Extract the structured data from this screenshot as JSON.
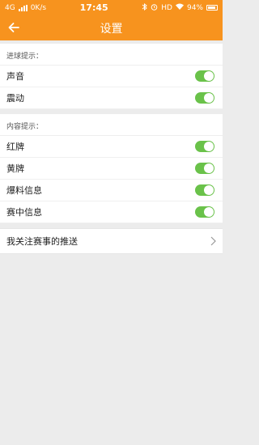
{
  "status": {
    "network": "4G",
    "speed": "0K/s",
    "time": "17:45",
    "hd": "HD",
    "battery": "94%"
  },
  "header": {
    "title": "设置"
  },
  "sections": {
    "goal": {
      "label": "进球提示：",
      "items": [
        {
          "label": "声音",
          "on": true
        },
        {
          "label": "震动",
          "on": true
        }
      ]
    },
    "content": {
      "label": "内容提示：",
      "items": [
        {
          "label": "红牌",
          "on": true
        },
        {
          "label": "黄牌",
          "on": true
        },
        {
          "label": "爆料信息",
          "on": true
        },
        {
          "label": "赛中信息",
          "on": true
        }
      ]
    }
  },
  "follow": {
    "label": "我关注赛事的推送"
  },
  "colors": {
    "accent": "#f7931e",
    "toggle_on": "#6ac24a"
  }
}
